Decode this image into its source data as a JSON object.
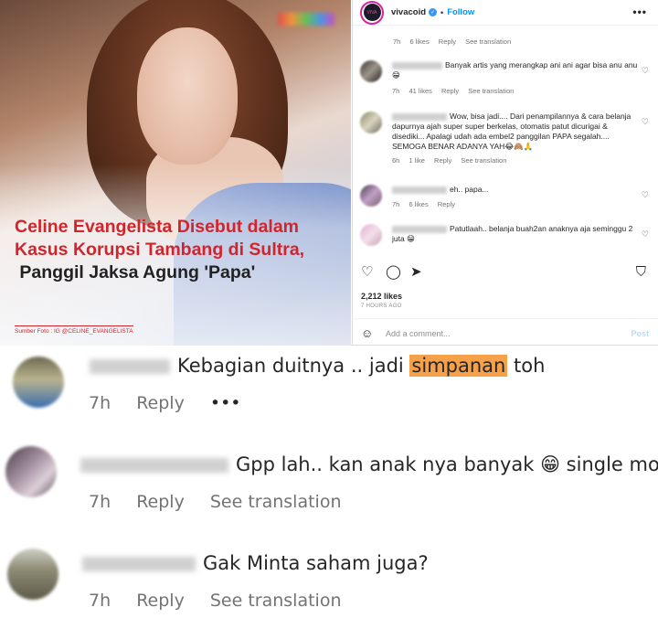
{
  "article": {
    "headline_red": "Celine Evangelista Disebut dalam Kasus Korupsi Tambang di Sultra,",
    "headline_dark": "Panggil Jaksa Agung",
    "headline_quote": "'Papa'",
    "source": "Sumber Foto : IG @CELINE_EVANGELISTA"
  },
  "instagram": {
    "account": "vivacoid",
    "follow": "Follow",
    "more": "•••",
    "top_meta": {
      "time": "7h",
      "likes": "6 likes",
      "reply": "Reply",
      "translate": "See translation"
    },
    "comments": [
      {
        "text": "Banyak artis yang merangkap ani ani agar bisa anu anu 😁",
        "time": "7h",
        "likes": "41 likes",
        "reply": "Reply",
        "translate": "See translation"
      },
      {
        "text": "Wow, bisa jadi.... Dari penampilannya & cara belanja dapurnya ajah super super berkelas, otomatis patut dicurigai & disediki... Apalagi udah ada embel2 panggilan PAPA segalah.... SEMOGA BENAR ADANYA YAH😂🙈🙏",
        "time": "6h",
        "likes": "1 like",
        "reply": "Reply",
        "translate": "See translation"
      },
      {
        "text": "eh.. papa...",
        "time": "7h",
        "likes": "6 likes",
        "reply": "Reply",
        "translate": ""
      },
      {
        "text": "Patutlaah.. belanja buah2an anaknya aja seminggu 2 juta 😁",
        "time": "",
        "likes": "",
        "reply": "",
        "translate": ""
      }
    ],
    "likes_total": "2,212 likes",
    "posted_ago": "7 HOURS AGO",
    "add_comment_placeholder": "Add a comment...",
    "post_label": "Post"
  },
  "zoomed_comments": [
    {
      "text_before": "Kebagian duitnya .. jadi ",
      "highlight": "simpanan",
      "text_after": " toh",
      "time": "7h",
      "reply": "Reply",
      "extra": "•••"
    },
    {
      "text_before": "Gpp lah.. kan anak nya banyak 😁 single mom",
      "highlight": "",
      "text_after": "",
      "time": "7h",
      "reply": "Reply",
      "extra": "See translation"
    },
    {
      "text_before": "Gak Minta saham juga?",
      "highlight": "",
      "text_after": "",
      "time": "7h",
      "reply": "Reply",
      "extra": "See translation"
    }
  ],
  "colors": {
    "headline_red": "#d3232b",
    "link_blue": "#0095f6",
    "highlight": "#f7a04a"
  }
}
